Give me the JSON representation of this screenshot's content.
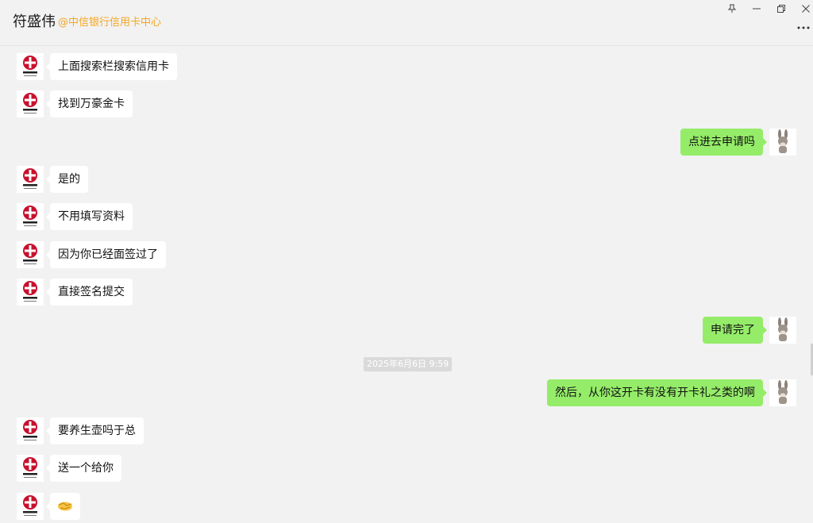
{
  "header": {
    "contact_name": "符盛伟",
    "contact_org": "@中信银行信用卡中心"
  },
  "window_controls": {
    "pin_icon": "pin-icon",
    "minimize_icon": "minimize-icon",
    "restore_icon": "restore-icon",
    "close_icon": "close-icon",
    "more_icon": "more-icon"
  },
  "colors": {
    "outgoing_bubble": "#95ec69",
    "incoming_bubble": "#ffffff",
    "org_text": "#f5a623",
    "bank_logo_red": "#c8102e"
  },
  "bank_avatar": {
    "name_text": "中信银行",
    "sub_text": "CHINA CITIC BANK"
  },
  "messages": [
    {
      "side": "in",
      "text": "上面搜索栏搜索信用卡"
    },
    {
      "side": "in",
      "text": "找到万豪金卡"
    },
    {
      "side": "out",
      "text": "点进去申请吗"
    },
    {
      "side": "in",
      "text": "是的"
    },
    {
      "side": "in",
      "text": "不用填写资料"
    },
    {
      "side": "in",
      "text": "因为你已经面签过了"
    },
    {
      "side": "in",
      "text": "直接签名提交"
    },
    {
      "side": "out",
      "text": "申请完了"
    },
    {
      "side": "out",
      "text": "然后，从你这开卡有没有开卡礼之类的啊"
    },
    {
      "side": "in",
      "text": "要养生壶吗于总"
    },
    {
      "side": "in",
      "text": "送一个给你"
    },
    {
      "side": "in",
      "text": "",
      "emoji": "handshake-icon"
    }
  ],
  "timestamp": "2025年6月6日 9:59"
}
